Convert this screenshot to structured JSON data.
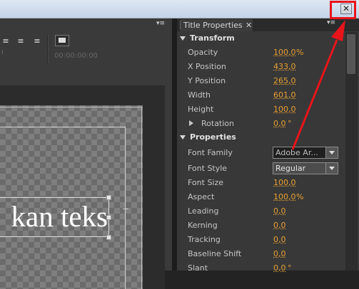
{
  "window": {
    "close_glyph": "✕"
  },
  "left_panel": {
    "menu_glyph": "▾≡",
    "align_glyphs": [
      "≡",
      "≡",
      "≡"
    ],
    "small_glyph": "⁞",
    "timecode": "00:00:00:00",
    "canvas_text": "kan teks"
  },
  "right_panel": {
    "tab_title": "Title Properties",
    "tab_close": "✕",
    "menu_glyph": "▾≡",
    "sections": {
      "transform": "Transform",
      "properties": "Properties"
    },
    "transform_props": [
      {
        "label": "Opacity",
        "value": "100,0",
        "unit": "%"
      },
      {
        "label": "X Position",
        "value": "433,0",
        "unit": ""
      },
      {
        "label": "Y Position",
        "value": "265,0",
        "unit": ""
      },
      {
        "label": "Width",
        "value": "601,0",
        "unit": ""
      },
      {
        "label": "Height",
        "value": "100,0",
        "unit": ""
      },
      {
        "label": "Rotation",
        "value": "0,0",
        "unit": "°"
      }
    ],
    "font_family": {
      "label": "Font Family",
      "value": "Adobe Ar..."
    },
    "font_style": {
      "label": "Font Style",
      "value": "Regular"
    },
    "other_props": [
      {
        "label": "Font Size",
        "value": "100,0",
        "unit": ""
      },
      {
        "label": "Aspect",
        "value": "100,0",
        "unit": "%"
      },
      {
        "label": "Leading",
        "value": "0,0",
        "unit": ""
      },
      {
        "label": "Kerning",
        "value": "0,0",
        "unit": ""
      },
      {
        "label": "Tracking",
        "value": "0,0",
        "unit": ""
      },
      {
        "label": "Baseline Shift",
        "value": "0,0",
        "unit": ""
      },
      {
        "label": "Slant",
        "value": "0,0",
        "unit": "°"
      }
    ]
  },
  "colors": {
    "accent_value": "#e8a033",
    "annotation": "#e8141b",
    "panel_bg": "#383838",
    "titlebar": "#c4d3e8"
  }
}
